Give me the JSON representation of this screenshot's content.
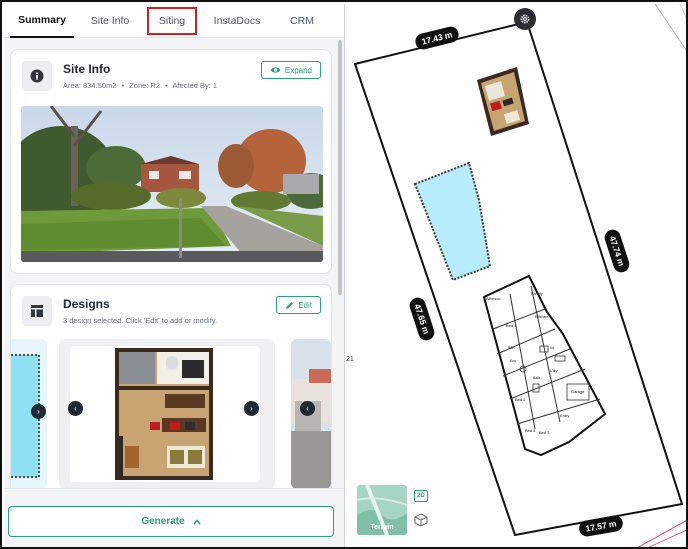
{
  "tabs": [
    {
      "label": "Summary",
      "active": true
    },
    {
      "label": "Site Info",
      "active": false
    },
    {
      "label": "Siting",
      "active": false,
      "highlighted": true
    },
    {
      "label": "InstaDocs",
      "active": false
    },
    {
      "label": "CRM",
      "active": false
    }
  ],
  "site_info": {
    "title": "Site Info",
    "area": "Area: 834.50m2",
    "zone": "Zone: R2",
    "affected": "Afected By: 1",
    "expand_label": "Expand",
    "icon": "info-icon"
  },
  "designs": {
    "title": "Designs",
    "subtitle": "3 design selected. Click 'Edit' to add or modify.",
    "edit_label": "Edit",
    "icon": "layout-icon"
  },
  "footer": {
    "generate_label": "Generate"
  },
  "map": {
    "dim_top": "17.43 m",
    "dim_right": "47.74 m",
    "dim_left": "47.65 m",
    "dim_bottom": "17.57 m",
    "edge_label": "21",
    "terrain_label": "Terrain",
    "view_2d_label": "2D",
    "plan_rooms": [
      "Alfresco",
      "Family",
      "Kitchen",
      "Bed 1",
      "Bed 2",
      "Bed 3",
      "Bed 4",
      "Garage",
      "Entry",
      "WIR",
      "Ens",
      "Bath",
      "L'dry",
      "Kit"
    ]
  },
  "colors": {
    "accent": "#2aa37a",
    "pool": "#b6ecfb",
    "highlight": "#d32020",
    "pill": "#111111"
  }
}
